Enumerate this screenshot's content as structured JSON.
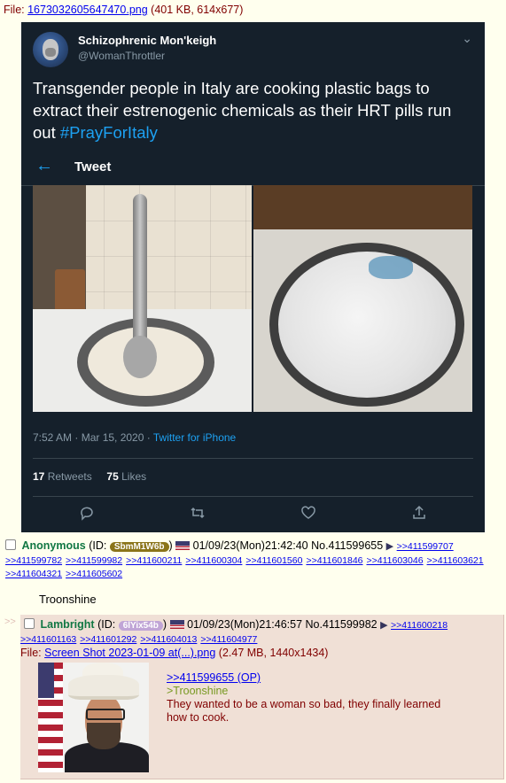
{
  "file": {
    "label": "File:",
    "name": "1673032605647470.png",
    "meta": "(401 KB, 614x677)"
  },
  "tweet": {
    "display_name": "Schizophrenic Mon'keigh",
    "handle": "@WomanThrottler",
    "text": "Transgender people in Italy are cooking plastic bags to extract their estrenogenic chemicals as their HRT pills run out",
    "hashtag": "#PrayForItaly",
    "header_label": "Tweet",
    "time": "7:52 AM · Mar 15, 2020 ·",
    "source": "Twitter for iPhone",
    "retweets_count": "17",
    "retweets_label": "Retweets",
    "likes_count": "75",
    "likes_label": "Likes",
    "icons": [
      "back-arrow-icon",
      "chevron-down-icon",
      "reply-icon",
      "retweet-icon",
      "like-icon",
      "share-icon"
    ]
  },
  "post1": {
    "name": "Anonymous",
    "id_prefix": "(ID:",
    "id": "SbmM1W6b",
    "id_suffix": ")",
    "datetime": "01/09/23(Mon)21:42:40",
    "number": "No.411599655",
    "replies": [
      ">>411599707",
      ">>411599782",
      ">>411599982",
      ">>411600211",
      ">>411600304",
      ">>411601560",
      ">>411601846",
      ">>411603046",
      ">>411603621",
      ">>411604321",
      ">>411605602"
    ],
    "message": "Troonshine"
  },
  "post2": {
    "name": "Lambright",
    "id_prefix": "(ID:",
    "id": "6lYix54b",
    "id_suffix": ")",
    "datetime": "01/09/23(Mon)21:46:57",
    "number": "No.411599982",
    "replies": [
      ">>411600218",
      ">>411601163",
      ">>411601292",
      ">>411604013",
      ">>411604977"
    ],
    "file_label": "File:",
    "file_name": "Screen Shot 2023-01-09 at(...).png",
    "file_meta": "(2.47 MB, 1440x1434)",
    "quote_link": ">>411599655 (OP)",
    "greentext": ">Troonshine",
    "message": "They wanted to be a woman so bad, they finally learned how to cook."
  },
  "colors": {
    "board_bg": "#ffffee",
    "reply_bg": "#f0e0d6",
    "name_green": "#117743",
    "greentext": "#789922",
    "link": "#0000ee",
    "tweet_bg": "#15202b",
    "tweet_blue": "#1da1f2"
  }
}
